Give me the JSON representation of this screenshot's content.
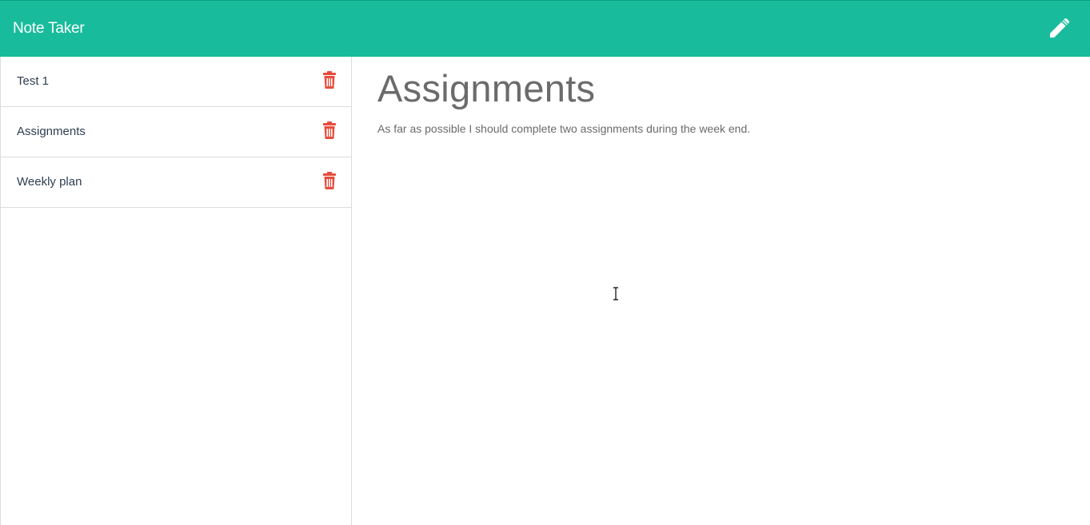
{
  "app": {
    "brand": "Note Taker"
  },
  "toolbar": {
    "new_note_icon": "pencil-icon"
  },
  "sidebar": {
    "notes": [
      {
        "title": "Test 1",
        "delete_icon": "trash-icon"
      },
      {
        "title": "Assignments",
        "delete_icon": "trash-icon"
      },
      {
        "title": "Weekly plan",
        "delete_icon": "trash-icon"
      }
    ]
  },
  "main": {
    "note_title": "Assignments",
    "note_text": "As far as possible I should complete two assignments during the week end."
  },
  "colors": {
    "navbar": "#18bc9c",
    "delete": "#e74c3c",
    "text_muted": "#6b6b6b"
  }
}
